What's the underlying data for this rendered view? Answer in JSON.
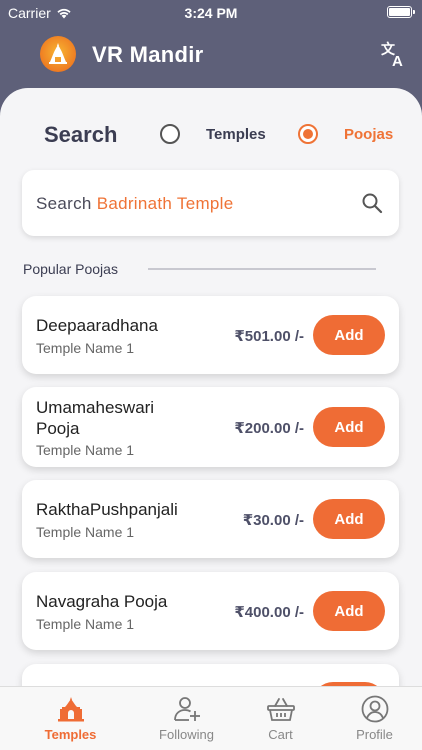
{
  "status_bar": {
    "carrier": "Carrier",
    "time": "3:24 PM"
  },
  "header": {
    "title": "VR Mandir"
  },
  "search": {
    "title": "Search",
    "options": [
      {
        "label": "Temples",
        "selected": false
      },
      {
        "label": "Poojas",
        "selected": true
      }
    ],
    "placeholder_prefix": "Search",
    "placeholder_example": "Badrinath Temple"
  },
  "section": {
    "title": "Popular Poojas"
  },
  "poojas": [
    {
      "name": "Deepaaradhana",
      "temple": "Temple Name 1",
      "price": "₹501.00 /-",
      "add_label": "Add"
    },
    {
      "name": "Umamaheswari Pooja",
      "temple": "Temple Name 1",
      "price": "₹200.00 /-",
      "add_label": "Add"
    },
    {
      "name": "RakthaPushpanjali",
      "temple": "Temple Name 1",
      "price": "₹30.00 /-",
      "add_label": "Add"
    },
    {
      "name": "Navagraha Pooja",
      "temple": "Temple Name 1",
      "price": "₹400.00 /-",
      "add_label": "Add"
    }
  ],
  "tabs": [
    {
      "label": "Temples",
      "icon": "temple-icon",
      "active": true
    },
    {
      "label": "Following",
      "icon": "add-user-icon",
      "active": false
    },
    {
      "label": "Cart",
      "icon": "basket-icon",
      "active": false
    },
    {
      "label": "Profile",
      "icon": "profile-icon",
      "active": false
    }
  ],
  "colors": {
    "accent": "#ef6c35",
    "header_bg": "#5e6079",
    "text_dark": "#3b3d52"
  }
}
